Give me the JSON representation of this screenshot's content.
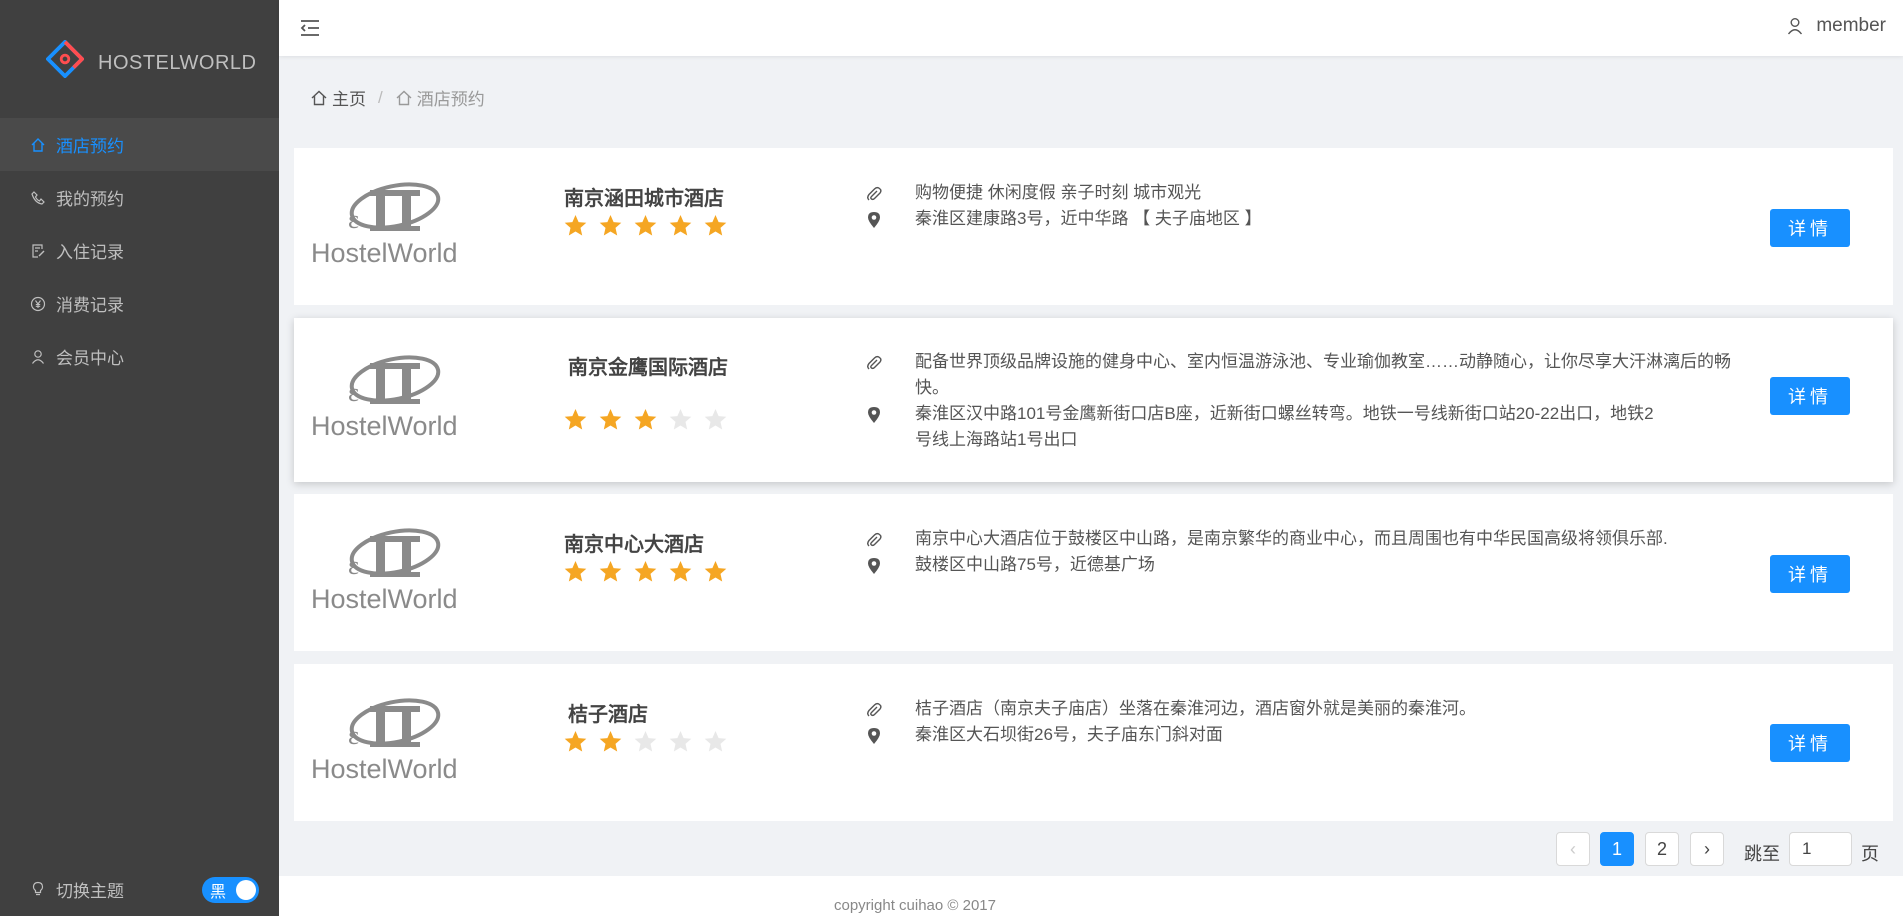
{
  "app": {
    "name": "HOSTELWORLD"
  },
  "sidebar": {
    "items": [
      {
        "label": "酒店预约",
        "icon": "home-icon",
        "active": true
      },
      {
        "label": "我的预约",
        "icon": "phone-icon",
        "active": false
      },
      {
        "label": "入住记录",
        "icon": "checkin-icon",
        "active": false
      },
      {
        "label": "消费记录",
        "icon": "yen-icon",
        "active": false
      },
      {
        "label": "会员中心",
        "icon": "user-icon",
        "active": false
      }
    ],
    "theme": {
      "label": "切换主题",
      "toggle_label": "黑",
      "on": true
    }
  },
  "header": {
    "user": "member"
  },
  "breadcrumb": {
    "home": "主页",
    "current": "酒店预约"
  },
  "hotels": [
    {
      "name": "南京涵田城市酒店",
      "logo_text": "HostelWorld",
      "rating": 5,
      "tags": "购物便捷 休闲度假 亲子时刻 城市观光",
      "address": "秦淮区建康路3号，近中华路 【 夫子庙地区 】",
      "button": "详情"
    },
    {
      "name": "南京金鹰国际酒店",
      "logo_text": "HostelWorld",
      "rating": 3,
      "tags": "配备世界顶级品牌设施的健身中心、室内恒温游泳池、专业瑜伽教室……动静随心，让你尽享大汗淋漓后的畅快。",
      "address": "秦淮区汉中路101号金鹰新街口店B座，近新街口螺丝转弯。地铁一号线新街口站20-22出口，地铁2号线上海路站1号出口",
      "button": "详情"
    },
    {
      "name": "南京中心大酒店",
      "logo_text": "HostelWorld",
      "rating": 5,
      "tags": "南京中心大酒店位于鼓楼区中山路，是南京繁华的商业中心，而且周围也有中华民国高级将领俱乐部.",
      "address": "鼓楼区中山路75号，近德基广场",
      "button": "详情"
    },
    {
      "name": "桔子酒店",
      "logo_text": "HostelWorld",
      "rating": 2,
      "tags": "桔子酒店（南京夫子庙店）坐落在秦淮河边，酒店窗外就是美丽的秦淮河。",
      "address": "秦淮区大石坝街26号，夫子庙东门斜对面",
      "button": "详情"
    }
  ],
  "pagination": {
    "prev": "‹",
    "next": "›",
    "pages": [
      "1",
      "2"
    ],
    "current": "1",
    "jump_label": "跳至",
    "jump_value": "1",
    "page_suffix": "页"
  },
  "footer": {
    "copyright": "copyright cuihao © 2017"
  },
  "colors": {
    "accent": "#1890ff",
    "star": "#f5a623",
    "star_empty": "#e8e8e8",
    "sidebar": "#404040"
  }
}
